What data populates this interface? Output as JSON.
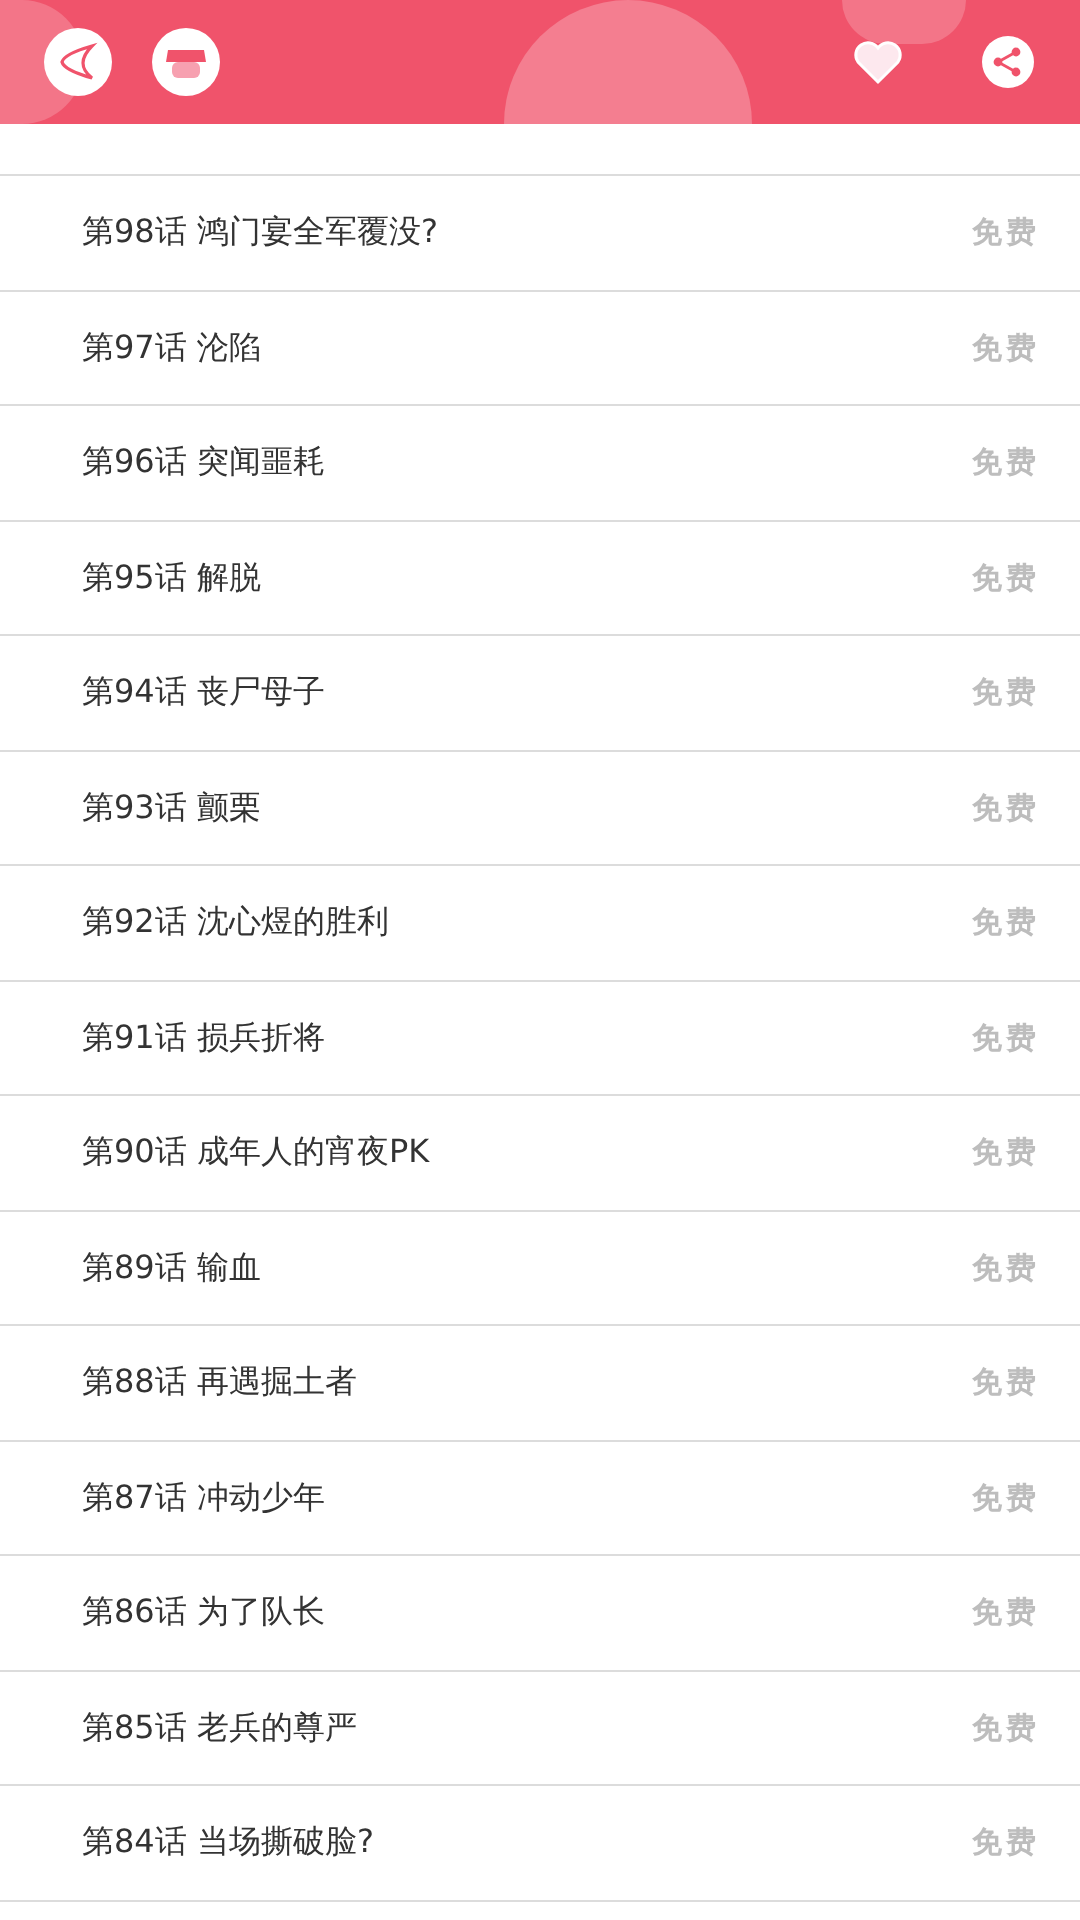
{
  "chapters": [
    {
      "title": "第98话 鸿门宴全军覆没?",
      "price": "免费"
    },
    {
      "title": "第97话 沦陷",
      "price": "免费"
    },
    {
      "title": "第96话 突闻噩耗",
      "price": "免费"
    },
    {
      "title": "第95话 解脱",
      "price": "免费"
    },
    {
      "title": "第94话 丧尸母子",
      "price": "免费"
    },
    {
      "title": "第93话 颤栗",
      "price": "免费"
    },
    {
      "title": "第92话 沈心煜的胜利",
      "price": "免费"
    },
    {
      "title": "第91话 损兵折将",
      "price": "免费"
    },
    {
      "title": "第90话 成年人的宵夜PK",
      "price": "免费"
    },
    {
      "title": "第89话 输血",
      "price": "免费"
    },
    {
      "title": "第88话 再遇掘土者",
      "price": "免费"
    },
    {
      "title": "第87话 冲动少年",
      "price": "免费"
    },
    {
      "title": "第86话 为了队长",
      "price": "免费"
    },
    {
      "title": "第85话 老兵的尊严",
      "price": "免费"
    },
    {
      "title": "第84话 当场撕破脸?",
      "price": "免费"
    }
  ]
}
